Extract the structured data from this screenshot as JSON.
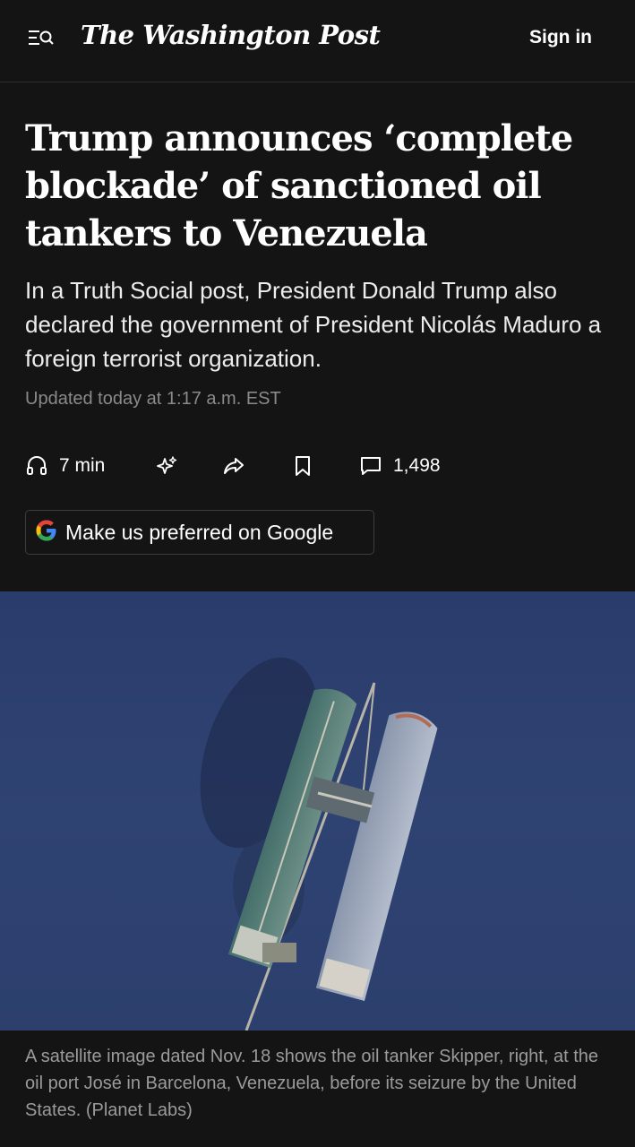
{
  "header": {
    "logo": "The Washington Post",
    "sign_in": "Sign in",
    "menu_icon": "menu-search-icon"
  },
  "article": {
    "headline": "Trump announces ‘complete blockade’ of sanctioned oil tankers to Venezuela",
    "dek": "In a Truth Social post, President Donald Trump also declared the government of President Nicolás Maduro a foreign terrorist organization.",
    "updated": "Updated today at 1:17 a.m. EST"
  },
  "actions": {
    "listen": {
      "icon": "headphones-icon",
      "label": "7 min"
    },
    "summary": {
      "icon": "sparkles-icon"
    },
    "share": {
      "icon": "share-arrow-icon"
    },
    "save": {
      "icon": "bookmark-icon"
    },
    "comments": {
      "icon": "comment-icon",
      "label": "1,498"
    }
  },
  "preferred": {
    "icon": "google-g-icon",
    "label": "Make us preferred on Google"
  },
  "photo": {
    "caption": "A satellite image dated Nov. 18 shows the oil tanker Skipper, right, at the oil port José in Barcelona, Venezuela, before its seizure by the United States. (Planet Labs)"
  },
  "colors": {
    "background": "#141414",
    "text": "#ffffff",
    "muted": "#8a8a8a",
    "sea": "#2c3d6d"
  }
}
